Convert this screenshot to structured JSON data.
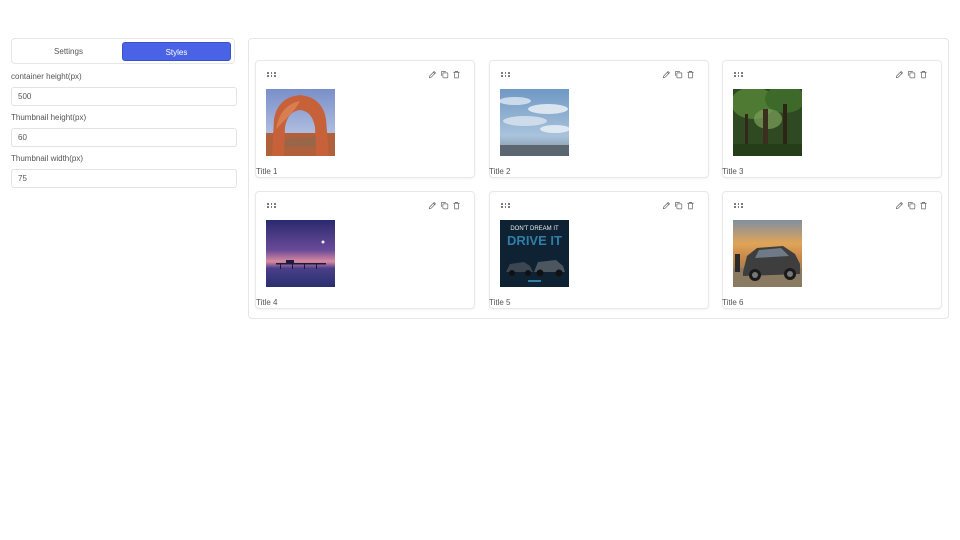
{
  "tabs": [
    {
      "label": "Settings",
      "active": false
    },
    {
      "label": "Styles",
      "active": true
    }
  ],
  "fields": {
    "container_height": {
      "label": "container height(px)",
      "value": "500"
    },
    "thumbnail_height": {
      "label": "Thumbnail height(px)",
      "value": "60"
    },
    "thumbnail_width": {
      "label": "Thumbnail width(px)",
      "value": "75"
    }
  },
  "cards": [
    {
      "title": "Title 1",
      "image": "arch-desert-photo"
    },
    {
      "title": "Title 2",
      "image": "cloudy-sky-photo"
    },
    {
      "title": "Title 3",
      "image": "forest-photo"
    },
    {
      "title": "Title 4",
      "image": "purple-sunset-pier-photo"
    },
    {
      "title": "Title 5",
      "image": "car-ad-drive-it-photo",
      "image_text": {
        "top": "DON'T DREAM IT",
        "main": "DRIVE IT"
      }
    },
    {
      "title": "Title 6",
      "image": "car-sunset-photo"
    }
  ],
  "card_icons": [
    "drag-handle-icon",
    "edit-icon",
    "copy-icon",
    "delete-icon"
  ],
  "colors": {
    "accent": "#4a63e6",
    "border": "#e6e6e6",
    "text": "#555555"
  }
}
